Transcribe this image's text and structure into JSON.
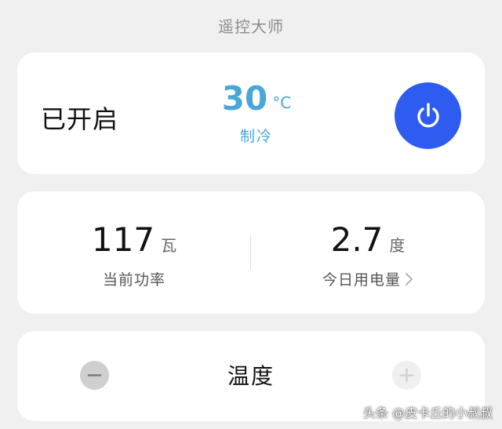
{
  "header": {
    "title": "遥控大师"
  },
  "status_card": {
    "status": "已开启",
    "temperature": "30",
    "temperature_unit": "°C",
    "mode": "制冷",
    "power_icon": "power-icon",
    "accent_color": "#2f5cf0",
    "temp_color": "#4aa6d6"
  },
  "energy_card": {
    "power_value": "117",
    "power_unit": "瓦",
    "power_label": "当前功率",
    "energy_value": "2.7",
    "energy_unit": "度",
    "energy_label": "今日用电量"
  },
  "temp_card": {
    "label": "温度",
    "minus_icon": "minus-icon",
    "plus_icon": "plus-icon"
  },
  "watermark": "头条 @皮卡丘的小叔叔"
}
